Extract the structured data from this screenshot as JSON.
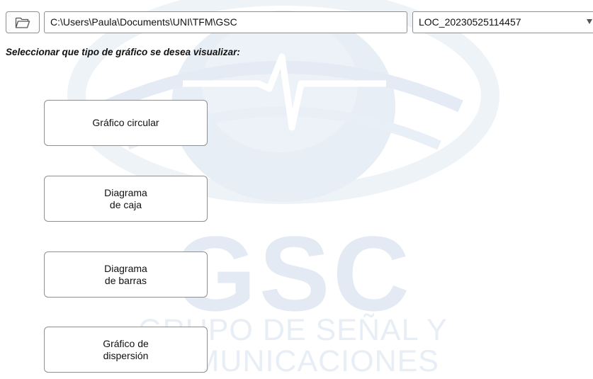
{
  "toolbar": {
    "path_value": "C:\\Users\\Paula\\Documents\\UNI\\TFM\\GSC",
    "location_selected": "LOC_20230525114457",
    "folder_icon": "folder-open-icon",
    "dropdown_icon": "caret-down-icon"
  },
  "prompt": "Seleccionar que tipo de gráfico se desea visualizar:",
  "buttons": [
    {
      "lines": [
        "Gráfico circular"
      ]
    },
    {
      "lines": [
        "Diagrama",
        "de caja"
      ]
    },
    {
      "lines": [
        "Diagrama",
        "de barras"
      ]
    },
    {
      "lines": [
        "Gráfico de",
        "dispersión"
      ]
    }
  ],
  "watermark": {
    "big": "GSC",
    "line1": "GRUPO DE SEÑAL Y",
    "line2": "COMUNICACIONES"
  },
  "colors": {
    "watermark": "#e3eaf3",
    "border": "#8f8f8f"
  }
}
